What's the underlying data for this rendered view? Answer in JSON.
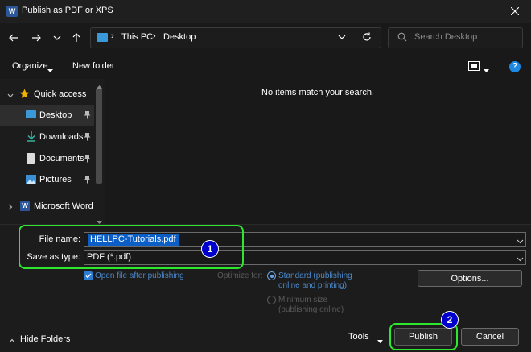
{
  "window": {
    "title": "Publish as PDF or XPS",
    "app_icon_letter": "W"
  },
  "nav": {
    "breadcrumb": [
      "This PC",
      "Desktop"
    ],
    "search_placeholder": "Search Desktop"
  },
  "toolbar": {
    "organize_label": "Organize",
    "new_folder_label": "New folder"
  },
  "sidebar": {
    "items": [
      {
        "label": "Quick access",
        "icon": "star-icon"
      },
      {
        "label": "Desktop",
        "icon": "desktop-icon",
        "pinned": true,
        "selected": true
      },
      {
        "label": "Downloads",
        "icon": "download-icon",
        "pinned": true
      },
      {
        "label": "Documents",
        "icon": "document-icon",
        "pinned": true
      },
      {
        "label": "Pictures",
        "icon": "pictures-icon",
        "pinned": true
      },
      {
        "label": "Microsoft Word",
        "icon": "word-icon"
      }
    ]
  },
  "content": {
    "empty_message": "No items match your search."
  },
  "form": {
    "file_name_label": "File name:",
    "file_name_value": "HELLPC-Tutorials.pdf",
    "save_as_type_label": "Save as type:",
    "save_as_type_value": "PDF (*.pdf)",
    "open_after_label": "Open file after publishing",
    "open_after_checked": true,
    "optimize_label": "Optimize for:",
    "optimize_options": [
      {
        "line1": "Standard (publishing",
        "line2": "online and printing)",
        "selected": true
      },
      {
        "line1": "Minimum size",
        "line2": "(publishing online)",
        "selected": false
      }
    ],
    "options_button": "Options..."
  },
  "footer": {
    "hide_folders_label": "Hide Folders",
    "tools_label": "Tools",
    "publish_button": "Publish",
    "cancel_button": "Cancel"
  },
  "annotations": {
    "badge1": "1",
    "badge2": "2",
    "highlight_color": "#2ee82e",
    "badge_color": "#0000cd"
  },
  "colors": {
    "accent": "#0a5ec5",
    "help_icon": "#1e88e5"
  }
}
